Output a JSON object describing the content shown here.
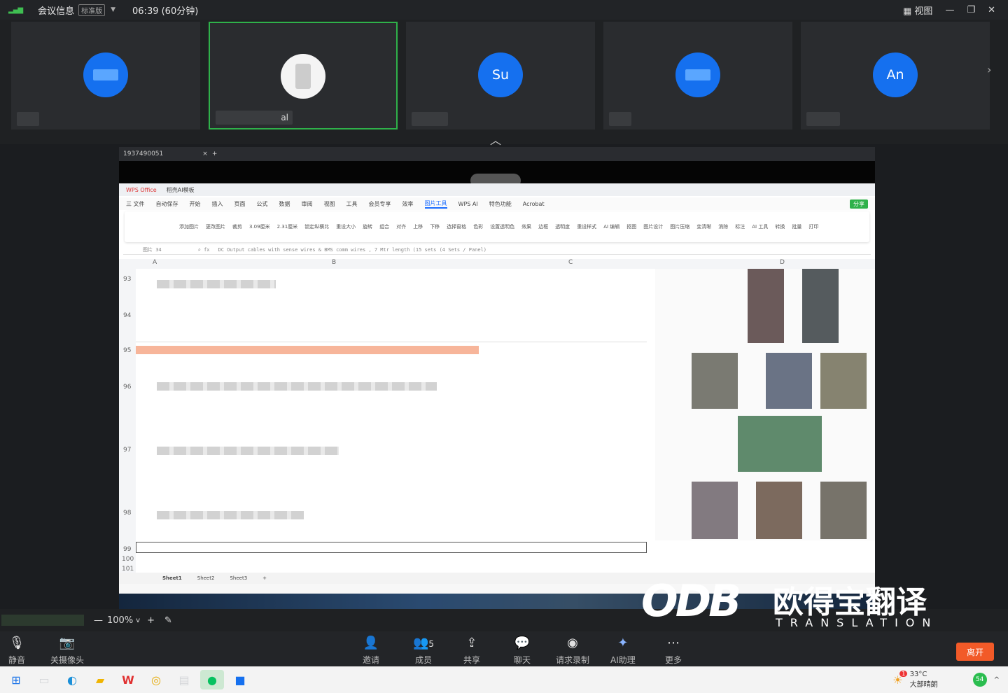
{
  "titlebar": {
    "title": "会议信息",
    "edition": "标准版",
    "duration": "06:39 (60分钟)",
    "view": "视图"
  },
  "participants": [
    {
      "initials": ""
    },
    {
      "initials": "",
      "name": "al"
    },
    {
      "initials": "Su"
    },
    {
      "initials": ""
    },
    {
      "initials": "An"
    }
  ],
  "share": {
    "meeting_id": "1937490051",
    "tab_close": "×",
    "tab_add": "+"
  },
  "wps": {
    "tabs": [
      "WPS Office",
      "稻壳AI模板"
    ],
    "menu": [
      "三 文件",
      "自动保存",
      "开始",
      "插入",
      "页面",
      "公式",
      "数据",
      "审阅",
      "视图",
      "工具",
      "会员专享",
      "效率",
      "图片工具",
      "WPS AI",
      "特色功能",
      "Acrobat"
    ],
    "active_menu": "图片工具",
    "share_btn": "分享",
    "ribbon": [
      "添加图片",
      "更改图片",
      "裁剪",
      "3.09厘米",
      "2.31厘米",
      "锁定纵横比",
      "重设大小",
      "旋转",
      "组合",
      "对齐",
      "上移",
      "下移",
      "选择窗格",
      "色彩",
      "设置透明色",
      "效果",
      "边框",
      "透明度",
      "重设样式",
      "AI 编辑",
      "抠图",
      "图片设计",
      "图片压缩",
      "变清晰",
      "消除",
      "标注",
      "AI 工具",
      "转换",
      "批量",
      "打印"
    ],
    "namebox": "图片 34",
    "formula": "DC Output cables with sense wires & BMS comm wires , 7 Mtr length (15 sets (4 Sets / Panel)",
    "columns": [
      "A",
      "B",
      "C",
      "D"
    ],
    "rows": [
      "93",
      "94",
      "95",
      "96",
      "97",
      "98",
      "99",
      "100",
      "101"
    ],
    "sheets": [
      "Sheet1",
      "Sheet2",
      "Sheet3",
      "+"
    ]
  },
  "zoom": {
    "level": "100%"
  },
  "toolbar": [
    {
      "icon": "mic-icon",
      "label": "静音"
    },
    {
      "icon": "camera-off-icon",
      "label": "关摄像头"
    },
    {
      "icon": "invite-icon",
      "label": "邀请"
    },
    {
      "icon": "members-icon",
      "label": "成员",
      "count": "5"
    },
    {
      "icon": "share-icon",
      "label": "共享"
    },
    {
      "icon": "chat-icon",
      "label": "聊天"
    },
    {
      "icon": "record-icon",
      "label": "请求录制"
    },
    {
      "icon": "ai-icon",
      "label": "AI助理"
    },
    {
      "icon": "more-icon",
      "label": "更多"
    }
  ],
  "leave": "离开",
  "taskbar": {
    "temp": "33°C",
    "weather": "大部晴朗",
    "badge": "1",
    "battery": "54"
  },
  "watermark": {
    "logo": "ODB",
    "cn": "欧得宝翻译",
    "en": "TRANSLATION"
  },
  "colors": {
    "accent": "#1570ef",
    "active_border": "#2fb14a",
    "leave": "#f25a28",
    "highlight_row": "#f7b59a"
  }
}
